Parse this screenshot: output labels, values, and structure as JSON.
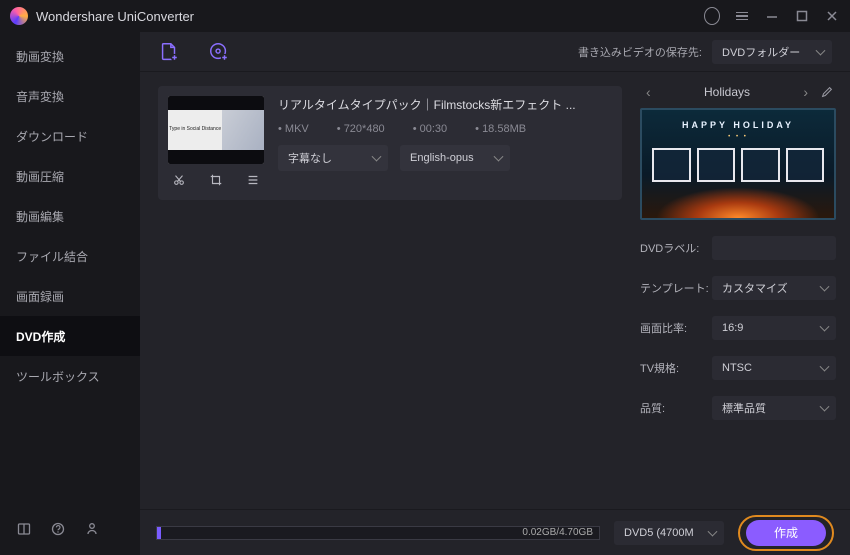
{
  "app": {
    "title": "Wondershare UniConverter"
  },
  "sidebar": {
    "items": [
      {
        "label": "動画変換"
      },
      {
        "label": "音声変換"
      },
      {
        "label": "ダウンロード"
      },
      {
        "label": "動画圧縮"
      },
      {
        "label": "動画編集"
      },
      {
        "label": "ファイル結合"
      },
      {
        "label": "画面録画"
      },
      {
        "label": "DVD作成"
      },
      {
        "label": "ツールボックス"
      }
    ],
    "active_index": 7
  },
  "toolbar": {
    "save_label": "書き込みビデオの保存先:",
    "save_dest": "DVDフォルダー"
  },
  "file": {
    "title": "リアルタイムタイプパック｜Filmstocks新エフェクト ...",
    "thumb_caption": "Type in\nSocial Distance",
    "format": "MKV",
    "resolution": "720*480",
    "duration": "00:30",
    "size": "18.58MB",
    "subtitle_sel": "字幕なし",
    "audio_sel": "English-opus"
  },
  "menu": {
    "name": "Holidays",
    "preview_title": "HAPPY HOLIDAY"
  },
  "settings": {
    "label_label": "DVDラベル:",
    "template_label": "テンプレート:",
    "template_value": "カスタマイズ",
    "aspect_label": "画面比率:",
    "aspect_value": "16:9",
    "tv_label": "TV規格:",
    "tv_value": "NTSC",
    "quality_label": "品質:",
    "quality_value": "標準品質"
  },
  "footer": {
    "progress_text": "0.02GB/4.70GB",
    "disc_type": "DVD5 (4700M",
    "burn_label": "作成"
  }
}
